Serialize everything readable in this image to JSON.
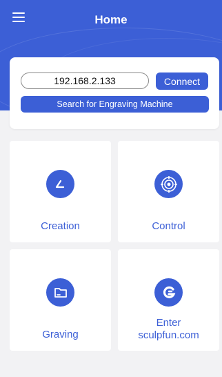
{
  "header": {
    "title": "Home",
    "menu_icon": "hamburger-menu-icon"
  },
  "connection": {
    "ip_value": "192.168.2.133",
    "connect_label": "Connect",
    "search_label": "Search for Engraving Machine"
  },
  "tiles": [
    {
      "label": "Creation",
      "icon": "pen-icon"
    },
    {
      "label": "Control",
      "icon": "target-control-icon"
    },
    {
      "label": "Graving",
      "icon": "folder-icon"
    },
    {
      "label_line1": "Enter",
      "label_line2": "sculpfun.com",
      "icon": "sculpfun-logo-icon"
    }
  ],
  "colors": {
    "accent": "#3c5fd6",
    "background": "#f2f2f4",
    "card": "#ffffff"
  }
}
